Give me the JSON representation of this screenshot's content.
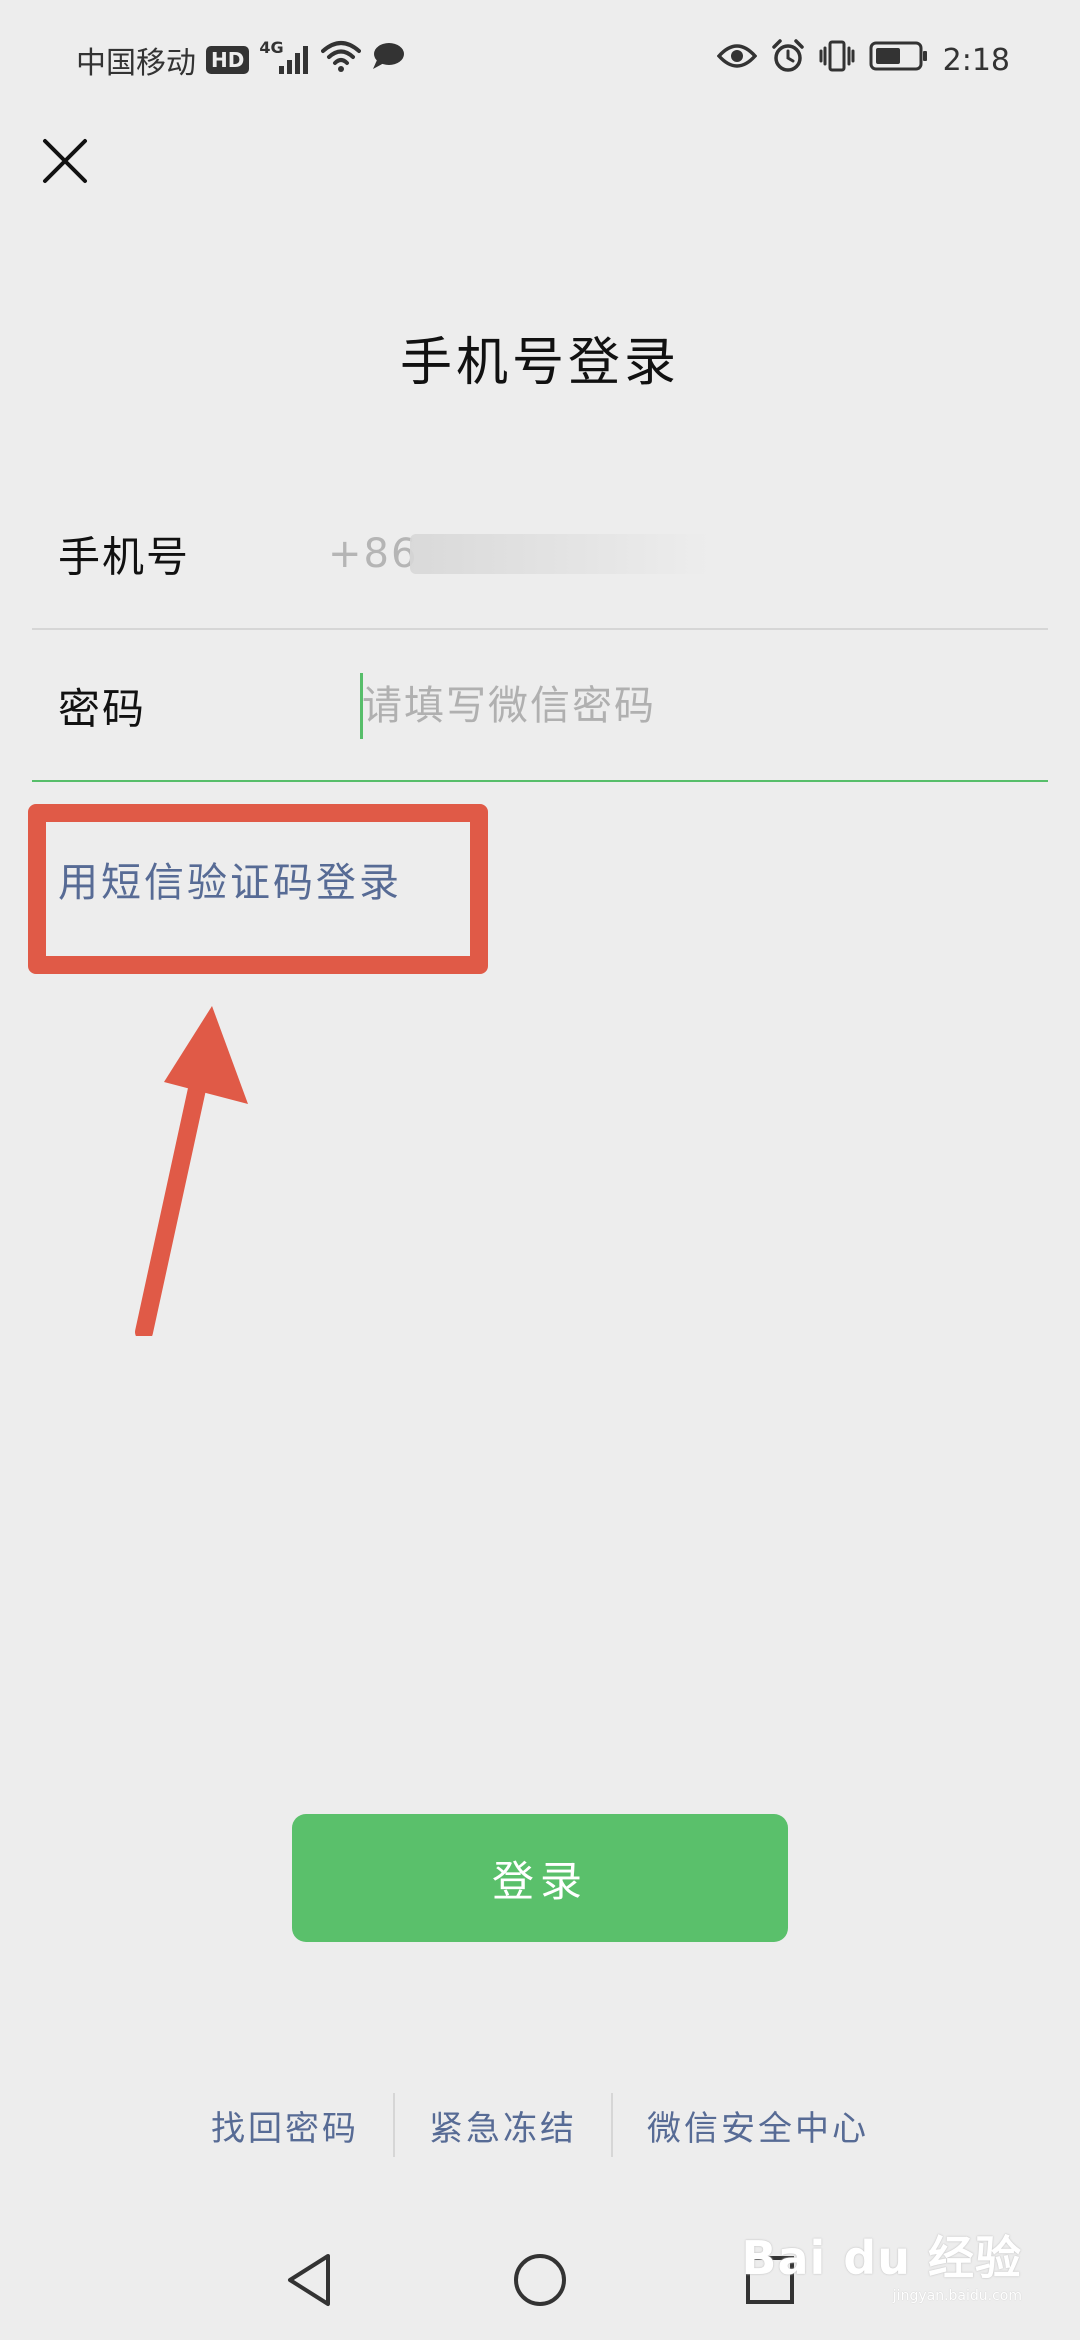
{
  "status_bar": {
    "carrier": "中国移动",
    "hd": "HD",
    "network": "4G",
    "time": "2:18"
  },
  "header": {
    "close_icon": "close-icon"
  },
  "page": {
    "title": "手机号登录"
  },
  "form": {
    "phone": {
      "label": "手机号",
      "value": "+86"
    },
    "password": {
      "label": "密码",
      "value": "",
      "placeholder": "请填写微信密码"
    }
  },
  "sms_login": {
    "label": "用短信验证码登录"
  },
  "login_button": {
    "label": "登录"
  },
  "bottom_links": [
    {
      "label": "找回密码"
    },
    {
      "label": "紧急冻结"
    },
    {
      "label": "微信安全中心"
    }
  ],
  "watermark": {
    "brand": "Bai du 经验",
    "url": "jingyan.baidu.com"
  },
  "colors": {
    "accent_green": "#5ac06b",
    "link_blue": "#576b95",
    "highlight_red": "#e05a47",
    "background": "#ededed"
  }
}
